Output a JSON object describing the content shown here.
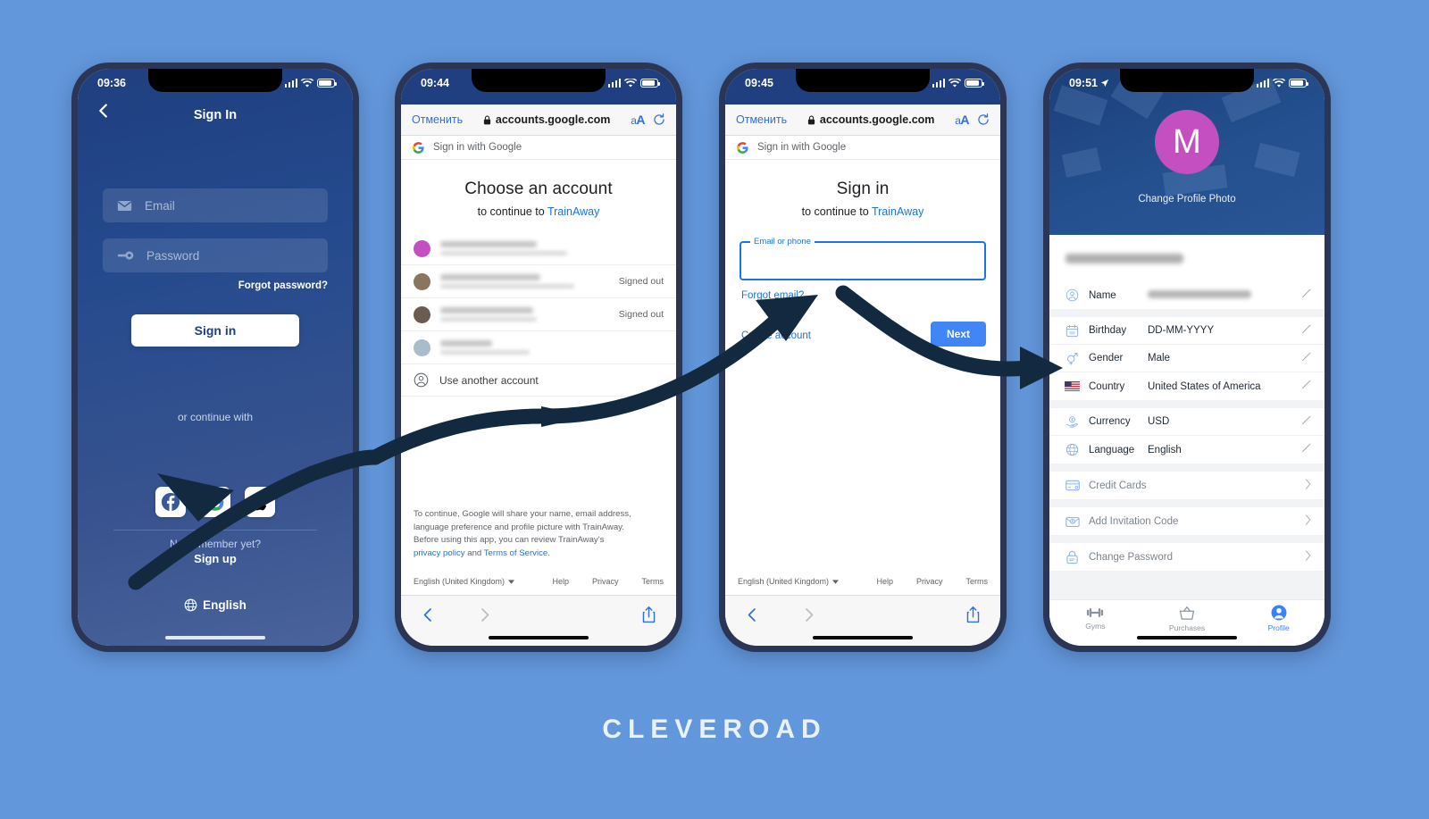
{
  "background_color": "#6397db",
  "brand": {
    "text": "CLEVEROAD"
  },
  "phone1": {
    "status": {
      "time": "09:36"
    },
    "header": {
      "title": "Sign In",
      "back_icon": "chevron-left-icon"
    },
    "fields": [
      {
        "icon": "envelope-icon",
        "placeholder": "Email"
      },
      {
        "icon": "key-icon",
        "placeholder": "Password"
      }
    ],
    "forgot_password": "Forgot password?",
    "sign_in_button": "Sign in",
    "or_continue_with": "or continue with",
    "socials": [
      "facebook-icon",
      "google-icon",
      "apple-icon"
    ],
    "not_member": "Not a member yet?",
    "sign_up": "Sign up",
    "language": "English"
  },
  "phone2": {
    "status": {
      "time": "09:44"
    },
    "browser": {
      "cancel": "Отменить",
      "url": "accounts.google.com",
      "lock_icon": "lock-icon",
      "text_size": "aA",
      "reload_icon": "reload-icon"
    },
    "google_header": "Sign in with Google",
    "title": "Choose an account",
    "subtitle_prefix": "to continue to ",
    "app_name": "TrainAway",
    "accounts": [
      {
        "avatar_color": "#c44fc0",
        "status": ""
      },
      {
        "avatar_color": "#8a7560",
        "status": "Signed out"
      },
      {
        "avatar_color": "#6b5b50",
        "status": "Signed out"
      },
      {
        "avatar_color": "#a8bcc9",
        "status": ""
      }
    ],
    "use_another_account": "Use another account",
    "disclaimer_line1": "To continue, Google will share your name, email address,",
    "disclaimer_line2": "language preference and profile picture with TrainAway.",
    "disclaimer_line3": "Before using this app, you can review TrainAway's",
    "privacy_policy": "privacy policy",
    "and_word": " and ",
    "terms_of_service": "Terms of Service",
    "footer_lang": "English (United Kingdom)",
    "footer_links": [
      "Help",
      "Privacy",
      "Terms"
    ],
    "toolbar": {
      "back_icon": "chevron-left-icon",
      "forward_icon": "chevron-right-icon",
      "share_icon": "share-icon"
    }
  },
  "phone3": {
    "status": {
      "time": "09:45"
    },
    "browser": {
      "cancel": "Отменить",
      "url": "accounts.google.com",
      "lock_icon": "lock-icon",
      "text_size": "aA",
      "reload_icon": "reload-icon"
    },
    "google_header": "Sign in with Google",
    "title": "Sign in",
    "subtitle_prefix": "to continue to ",
    "app_name": "TrainAway",
    "email_field": {
      "label": "Email or phone",
      "value": ""
    },
    "forgot_email": "Forgot email?",
    "create_account": "Create account",
    "next_button": "Next",
    "footer_lang": "English (United Kingdom)",
    "footer_links": [
      "Help",
      "Privacy",
      "Terms"
    ],
    "toolbar": {
      "back_icon": "chevron-left-icon",
      "forward_icon": "chevron-right-icon",
      "share_icon": "share-icon"
    }
  },
  "phone4": {
    "status": {
      "time": "09:51",
      "location_icon": "location-arrow-icon"
    },
    "avatar_letter": "M",
    "avatar_color": "#c44fc0",
    "change_profile_photo": "Change Profile Photo",
    "group1": [
      {
        "icon": "user-circle-icon",
        "label": "Name",
        "value": "",
        "blurred": true,
        "edit_icon": "pencil-icon"
      }
    ],
    "group2": [
      {
        "icon": "calendar-icon",
        "label": "Birthday",
        "value": "DD-MM-YYYY",
        "edit_icon": "pencil-icon"
      },
      {
        "icon": "gender-icon",
        "label": "Gender",
        "value": "Male",
        "edit_icon": "pencil-icon"
      },
      {
        "icon": "flag-us-icon",
        "label": "Country",
        "value": "United States of America",
        "edit_icon": "pencil-icon"
      }
    ],
    "group3": [
      {
        "icon": "currency-hand-icon",
        "label": "Currency",
        "value": "USD",
        "edit_icon": "pencil-icon"
      },
      {
        "icon": "globe-icon",
        "label": "Language",
        "value": "English",
        "edit_icon": "pencil-icon"
      }
    ],
    "group4": [
      {
        "icon": "credit-card-icon",
        "label": "Credit Cards",
        "chevron_icon": "chevron-right-icon"
      }
    ],
    "group5": [
      {
        "icon": "invitation-icon",
        "label": "Add Invitation Code",
        "chevron_icon": "chevron-right-icon"
      }
    ],
    "group6": [
      {
        "icon": "lock-check-icon",
        "label": "Change Password",
        "chevron_icon": "chevron-right-icon"
      }
    ],
    "tabs": [
      {
        "icon": "dumbbell-icon",
        "label": "Gyms",
        "active": false
      },
      {
        "icon": "basket-icon",
        "label": "Purchases",
        "active": false
      },
      {
        "icon": "person-filled-icon",
        "label": "Profile",
        "active": true
      }
    ],
    "accent_color": "#3b82f6"
  }
}
